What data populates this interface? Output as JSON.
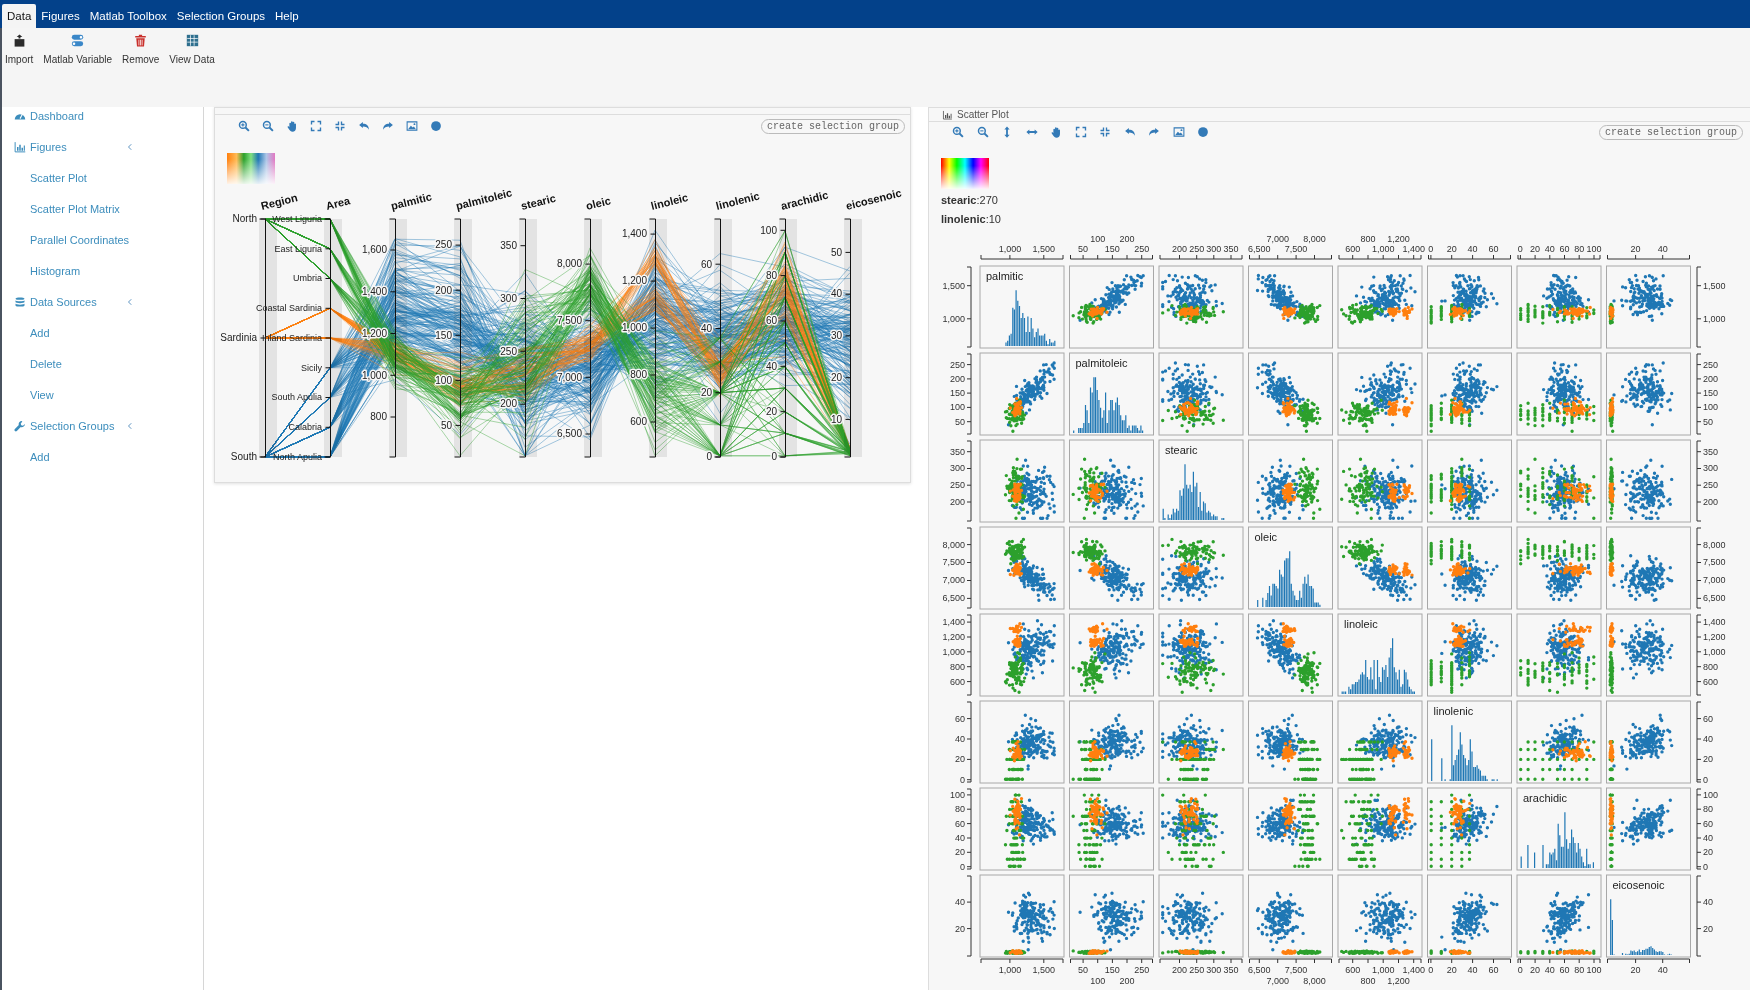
{
  "menu_bar": {
    "tabs": [
      {
        "label": "Data",
        "selected": true
      },
      {
        "label": "Figures",
        "selected": false
      },
      {
        "label": "Matlab Toolbox",
        "selected": false
      },
      {
        "label": "Selection Groups",
        "selected": false
      },
      {
        "label": "Help",
        "selected": false
      }
    ]
  },
  "ribbon": {
    "buttons": [
      {
        "label": "Import",
        "kind": "import"
      },
      {
        "label": "Matlab Variable",
        "kind": "variable"
      },
      {
        "label": "Remove",
        "kind": "remove"
      },
      {
        "label": "View Data",
        "kind": "table"
      }
    ]
  },
  "sidebar": {
    "items": [
      {
        "label": "Dashboard",
        "kind": "dashboard"
      },
      {
        "label": "Figures",
        "kind": "figures",
        "children": [
          {
            "label": "Scatter Plot"
          },
          {
            "label": "Scatter Plot Matrix"
          },
          {
            "label": "Parallel Coordinates"
          },
          {
            "label": "Histogram"
          }
        ]
      },
      {
        "label": "Data Sources",
        "kind": "sources",
        "children": [
          {
            "label": "Add"
          },
          {
            "label": "Delete"
          },
          {
            "label": "View"
          }
        ]
      },
      {
        "label": "Selection Groups",
        "kind": "groups",
        "children": [
          {
            "label": "Add"
          }
        ]
      }
    ]
  },
  "parallel_coordinates": {
    "button": "create selection group",
    "axes": [
      {
        "title": "Region",
        "kind": "category",
        "ticks": [
          "North",
          "Sardinia",
          "South"
        ]
      },
      {
        "title": "Area",
        "kind": "category",
        "ticks": [
          "West Liguria",
          "East Liguria",
          "Umbria",
          "Coastal Sardinia",
          "Inland Sardinia",
          "Sicily",
          "South Apulia",
          "Calabria",
          "North Apulia"
        ]
      },
      {
        "title": "palmitic",
        "kind": "numeric",
        "ticks": [
          "1,600",
          "1,400",
          "1,200",
          "1,000",
          "800"
        ]
      },
      {
        "title": "palmitoleic",
        "kind": "numeric",
        "ticks": [
          "250",
          "200",
          "150",
          "100",
          "50"
        ]
      },
      {
        "title": "stearic",
        "kind": "numeric",
        "ticks": [
          "350",
          "300",
          "250",
          "200"
        ]
      },
      {
        "title": "oleic",
        "kind": "numeric",
        "ticks": [
          "8,000",
          "7,500",
          "7,000",
          "6,500"
        ]
      },
      {
        "title": "linoleic",
        "kind": "numeric",
        "ticks": [
          "1,400",
          "1,200",
          "1,000",
          "800",
          "600"
        ]
      },
      {
        "title": "linolenic",
        "kind": "numeric",
        "ticks": [
          "60",
          "40",
          "20",
          "0"
        ]
      },
      {
        "title": "arachidic",
        "kind": "numeric",
        "ticks": [
          "100",
          "80",
          "60",
          "40",
          "20",
          "0"
        ]
      },
      {
        "title": "eicosenoic",
        "kind": "numeric",
        "ticks": [
          "50",
          "40",
          "30",
          "20",
          "10"
        ]
      }
    ]
  },
  "scatter_matrix": {
    "title": "Scatter Plot",
    "button": "create selection group",
    "info": [
      "**stearic**:270",
      "**linolenic**:10"
    ],
    "variables": [
      "palmitic",
      "palmitoleic",
      "stearic",
      "oleic",
      "linoleic",
      "linolenic",
      "arachidic",
      "eicosenoic"
    ],
    "top_axis": [
      [
        "1,000",
        "1,500"
      ],
      [
        "50",
        "100",
        "150",
        "200",
        "250"
      ],
      [
        "200",
        "250",
        "300",
        "350"
      ],
      [
        "6,500",
        "7,000",
        "7,500",
        "8,000"
      ],
      [
        "600",
        "800",
        "1,000",
        "1,200",
        "1,400"
      ],
      [
        "0",
        "20",
        "40",
        "60"
      ],
      [
        "0",
        "20",
        "40",
        "60",
        "80",
        "100"
      ],
      [
        "20",
        "40"
      ]
    ],
    "bottom_axis": [
      [
        "1,000",
        "1,500"
      ],
      [
        "50",
        "100",
        "150",
        "200",
        "250"
      ],
      [
        "200",
        "250",
        "300",
        "350"
      ],
      [
        "6,500",
        "7,000",
        "7,500",
        "8,000"
      ],
      [
        "600",
        "800",
        "1,000",
        "1,200",
        "1,400"
      ],
      [
        "0",
        "20",
        "40",
        "60"
      ],
      [
        "0",
        "20",
        "40",
        "60",
        "80",
        "100"
      ],
      [
        "20",
        "40"
      ]
    ],
    "left_axis": [
      [
        "1,500",
        "1,000"
      ],
      [
        "250",
        "200",
        "150",
        "100",
        "50"
      ],
      [
        "350",
        "300",
        "250",
        "200"
      ],
      [
        "8,000",
        "7,500",
        "7,000",
        "6,500"
      ],
      [
        "1,400",
        "1,200",
        "1,000",
        "800",
        "600"
      ],
      [
        "60",
        "40",
        "20",
        "0"
      ],
      [
        "100",
        "80",
        "60",
        "40",
        "20",
        "0"
      ],
      [
        "40",
        "20"
      ]
    ],
    "right_axis": [
      [
        "1,500",
        "1,000"
      ],
      [
        "250",
        "200",
        "150",
        "100",
        "50"
      ],
      [
        "350",
        "300",
        "250",
        "200"
      ],
      [
        "8,000",
        "7,500",
        "7,000",
        "6,500"
      ],
      [
        "1,400",
        "1,200",
        "1,000",
        "800",
        "600"
      ],
      [
        "60",
        "40",
        "20",
        "0"
      ],
      [
        "100",
        "80",
        "60",
        "40",
        "20",
        "0"
      ],
      [
        "40",
        "20"
      ]
    ]
  }
}
